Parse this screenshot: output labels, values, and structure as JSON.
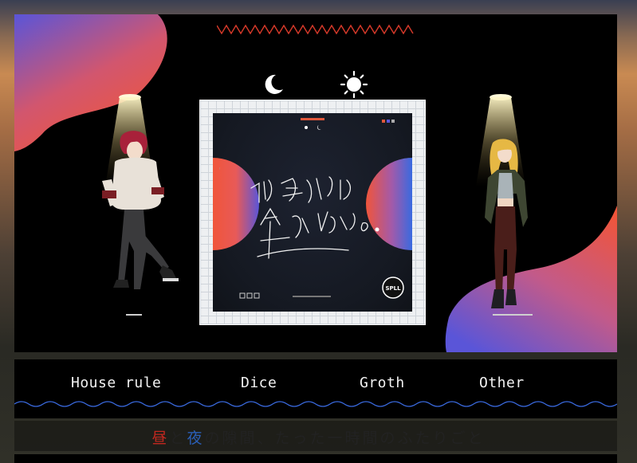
{
  "nav": {
    "items": [
      {
        "label": "House rule"
      },
      {
        "label": "Dice"
      },
      {
        "label": "Groth"
      },
      {
        "label": "Other"
      }
    ]
  },
  "tagline": {
    "part1": "昼",
    "part2": "と",
    "part3": "夜",
    "part4": "の隙間、たった一時間のふたりごと"
  },
  "cover": {
    "title_line1": "同じ空には",
    "title_line2": "昇れない。",
    "badge": "SPLL"
  },
  "colors": {
    "red": "#c2281f",
    "blue": "#2a5fb8",
    "orange": "#f0553a",
    "purple": "#5a55d8"
  },
  "icons": {
    "moon": "moon-icon",
    "sun": "sun-icon"
  }
}
